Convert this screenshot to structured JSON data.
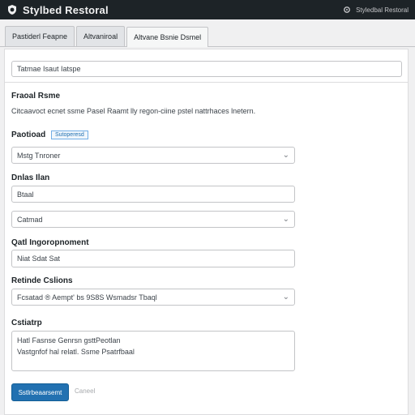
{
  "app": {
    "title": "Stylbed Restoral"
  },
  "topbar": {
    "user_text": "Styledbal Restoral"
  },
  "tabs": [
    {
      "label": "Pastiderl Feapne"
    },
    {
      "label": "Altvaniroal"
    },
    {
      "label": "Altvane Bsnie Dsmel"
    }
  ],
  "form": {
    "top_input": {
      "value": "Tatmae Isaut Iatspe"
    },
    "section_heading": "Fraoal Rsme",
    "section_desc": "Citcaavoct ecnet ssme Pasel Raamt lly regon-ciine pstel nattrhaces lnetern.",
    "field1": {
      "label": "Paotioad",
      "badge": "Sutoperesd",
      "value": "Mstg Tnroner"
    },
    "field2": {
      "label": "Dnlas Ilan",
      "value1": "Btaal",
      "value2": "Catmad"
    },
    "field3": {
      "label": "Qatl Ingoropnoment",
      "value": "Niat Sdat Sat"
    },
    "field4": {
      "label": "Retinde Cslions",
      "value": "Fcsatad  ®  Aempt' bs  9S8S  Wsmadsr Tbaql"
    },
    "field5": {
      "label": "Cstiatrp",
      "line1": "Hatl Fasnse Genrsn gsttPeotlan",
      "line2": "Vastgnfof hal relatl. Ssme Psatrfbaal"
    },
    "primary_button": "Sstlrbeaarsemt",
    "secondary_button": "Caneel"
  }
}
